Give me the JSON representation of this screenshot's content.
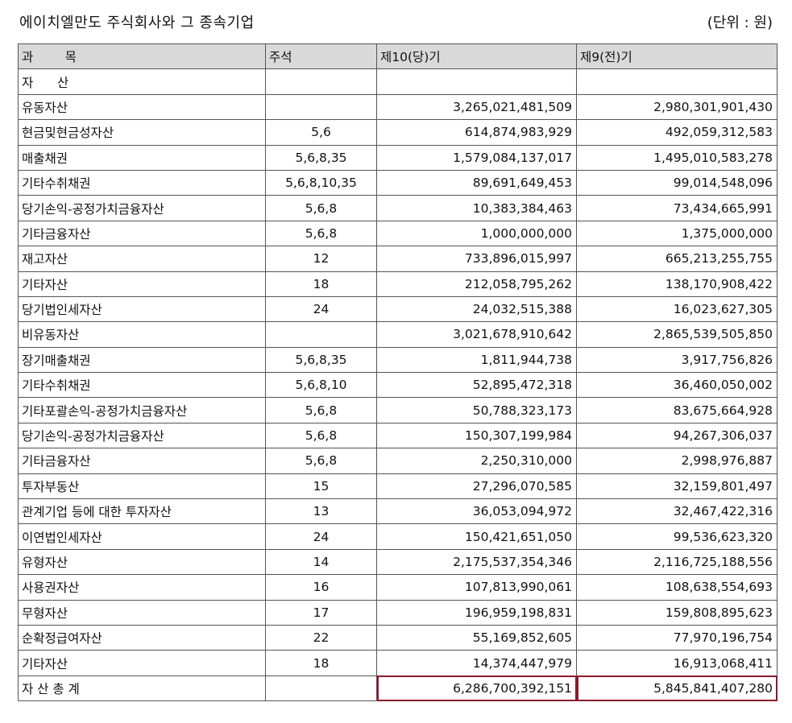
{
  "header": {
    "title": "에이치엘만도 주식회사와 그 종속기업",
    "unit": "(단위 : 원)"
  },
  "table": {
    "columns": [
      "과        목",
      "주석",
      "제10(당)기",
      "제9(전)기"
    ],
    "rows": [
      {
        "item": "자      산",
        "note": "",
        "current": "",
        "prior": ""
      },
      {
        "item": "유동자산",
        "note": "",
        "current": "3,265,021,481,509",
        "prior": "2,980,301,901,430"
      },
      {
        "item": "현금및현금성자산",
        "note": "5,6",
        "current": "614,874,983,929",
        "prior": "492,059,312,583"
      },
      {
        "item": "매출채권",
        "note": "5,6,8,35",
        "current": "1,579,084,137,017",
        "prior": "1,495,010,583,278"
      },
      {
        "item": "기타수취채권",
        "note": "5,6,8,10,35",
        "current": "89,691,649,453",
        "prior": "99,014,548,096"
      },
      {
        "item": "당기손익-공정가치금융자산",
        "note": "5,6,8",
        "current": "10,383,384,463",
        "prior": "73,434,665,991"
      },
      {
        "item": "기타금융자산",
        "note": "5,6,8",
        "current": "1,000,000,000",
        "prior": "1,375,000,000"
      },
      {
        "item": "재고자산",
        "note": "12",
        "current": "733,896,015,997",
        "prior": "665,213,255,755"
      },
      {
        "item": "기타자산",
        "note": "18",
        "current": "212,058,795,262",
        "prior": "138,170,908,422"
      },
      {
        "item": "당기법인세자산",
        "note": "24",
        "current": "24,032,515,388",
        "prior": "16,023,627,305"
      },
      {
        "item": "비유동자산",
        "note": "",
        "current": "3,021,678,910,642",
        "prior": "2,865,539,505,850"
      },
      {
        "item": "장기매출채권",
        "note": "5,6,8,35",
        "current": "1,811,944,738",
        "prior": "3,917,756,826"
      },
      {
        "item": "기타수취채권",
        "note": "5,6,8,10",
        "current": "52,895,472,318",
        "prior": "36,460,050,002"
      },
      {
        "item": "기타포괄손익-공정가치금융자산",
        "note": "5,6,8",
        "current": "50,788,323,173",
        "prior": "83,675,664,928"
      },
      {
        "item": "당기손익-공정가치금융자산",
        "note": "5,6,8",
        "current": "150,307,199,984",
        "prior": "94,267,306,037"
      },
      {
        "item": "기타금융자산",
        "note": "5,6,8",
        "current": "2,250,310,000",
        "prior": "2,998,976,887"
      },
      {
        "item": "투자부동산",
        "note": "15",
        "current": "27,296,070,585",
        "prior": "32,159,801,497"
      },
      {
        "item": "관계기업 등에 대한 투자자산",
        "note": "13",
        "current": "36,053,094,972",
        "prior": "32,467,422,316"
      },
      {
        "item": "이연법인세자산",
        "note": "24",
        "current": "150,421,651,050",
        "prior": "99,536,623,320"
      },
      {
        "item": "유형자산",
        "note": "14",
        "current": "2,175,537,354,346",
        "prior": "2,116,725,188,556"
      },
      {
        "item": "사용권자산",
        "note": "16",
        "current": "107,813,990,061",
        "prior": "108,638,554,693"
      },
      {
        "item": "무형자산",
        "note": "17",
        "current": "196,959,198,831",
        "prior": "159,808,895,623"
      },
      {
        "item": "순확정급여자산",
        "note": "22",
        "current": "55,169,852,605",
        "prior": "77,970,196,754"
      },
      {
        "item": "기타자산",
        "note": "18",
        "current": "14,374,447,979",
        "prior": "16,913,068,411"
      },
      {
        "item": "자 산 총 계",
        "note": "",
        "current": "6,286,700,392,151",
        "prior": "5,845,841,407,280"
      }
    ]
  },
  "colors": {
    "header_bg": "#d9d9d9",
    "border": "#555555",
    "highlight": "#8b1a2b"
  }
}
